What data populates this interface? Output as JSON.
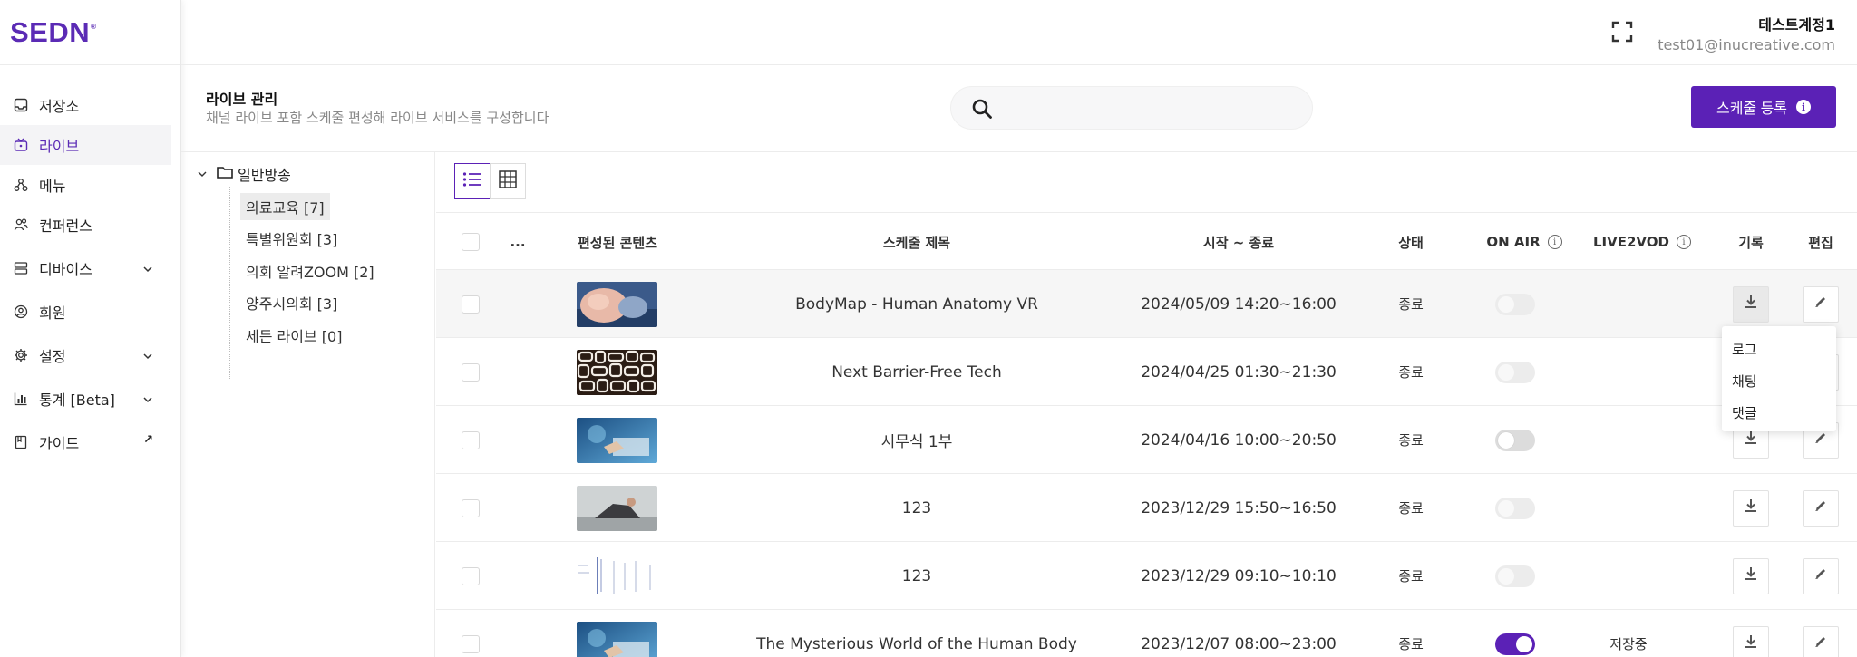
{
  "brand": {
    "logo": "SEDN",
    "mark": "®"
  },
  "sidebar": {
    "items": [
      {
        "label": "저장소",
        "icon": "storage-icon"
      },
      {
        "label": "라이브",
        "icon": "live-tv-icon",
        "active": true
      },
      {
        "label": "메뉴",
        "icon": "menu-tree-icon"
      },
      {
        "label": "컨퍼런스",
        "icon": "conference-icon"
      },
      {
        "label": "디바이스",
        "icon": "device-icon",
        "expandable": true
      },
      {
        "label": "회원",
        "icon": "member-icon"
      },
      {
        "label": "설정",
        "icon": "settings-gear-icon",
        "expandable": true
      },
      {
        "label": "통계 [Beta]",
        "icon": "bar-chart-icon",
        "expandable": true
      },
      {
        "label": "가이드",
        "icon": "guide-book-icon",
        "external_arrow": "↗"
      }
    ]
  },
  "user": {
    "name": "테스트계정1",
    "email": "test01@inucreative.com"
  },
  "page": {
    "title": "라이브 관리",
    "subtitle": "채널 라이브 포함 스케줄 편성해 라이브 서비스를 구성합니다",
    "search_placeholder": "",
    "schedule_button": "스케줄 등록",
    "info_glyph": "i"
  },
  "tree": {
    "root": "일반방송",
    "items": [
      "의료교육 [7]",
      "특별위원회 [3]",
      "의회 알려ZOOM [2]",
      "양주시의회 [3]",
      "세든 라이브 [0]"
    ]
  },
  "table": {
    "headers": {
      "more": "...",
      "content": "편성된 콘텐츠",
      "title": "스케줄 제목",
      "time": "시작 ~ 종료",
      "status": "상태",
      "onair": "ON AIR",
      "live2vod": "LIVE2VOD",
      "record": "기록",
      "edit": "편집",
      "info_glyph": "i"
    },
    "rows": [
      {
        "title": "BodyMap - Human Anatomy VR",
        "time": "2024/05/09 14:20~16:00",
        "status": "종료",
        "onair": "off",
        "live2vod": "",
        "thumb": "anatomy"
      },
      {
        "title": "Next Barrier-Free Tech",
        "time": "2024/04/25 01:30~21:30",
        "status": "종료",
        "onair": "off",
        "live2vod": "",
        "thumb": "pattern"
      },
      {
        "title": "시무식 1부",
        "time": "2024/04/16 10:00~20:50",
        "status": "종료",
        "onair": "off",
        "live2vod": "",
        "thumb": "tech-blue"
      },
      {
        "title": "123",
        "time": "2023/12/29 15:50~16:50",
        "status": "종료",
        "onair": "off",
        "live2vod": "",
        "thumb": "person"
      },
      {
        "title": "123",
        "time": "2023/12/29 09:10~10:10",
        "status": "종료",
        "onair": "off",
        "live2vod": "",
        "thumb": "document"
      },
      {
        "title": "The Mysterious World of the Human Body",
        "time": "2023/12/07 08:00~23:00",
        "status": "종료",
        "onair": "on",
        "live2vod": "저장중",
        "thumb": "tech-blue"
      }
    ]
  },
  "record_dropdown": {
    "items": [
      "로그",
      "채팅",
      "댓글"
    ]
  },
  "colors": {
    "brand": "#5b21b6",
    "logo": "#5b2bb5",
    "toggle_on": "#5b21b6"
  }
}
